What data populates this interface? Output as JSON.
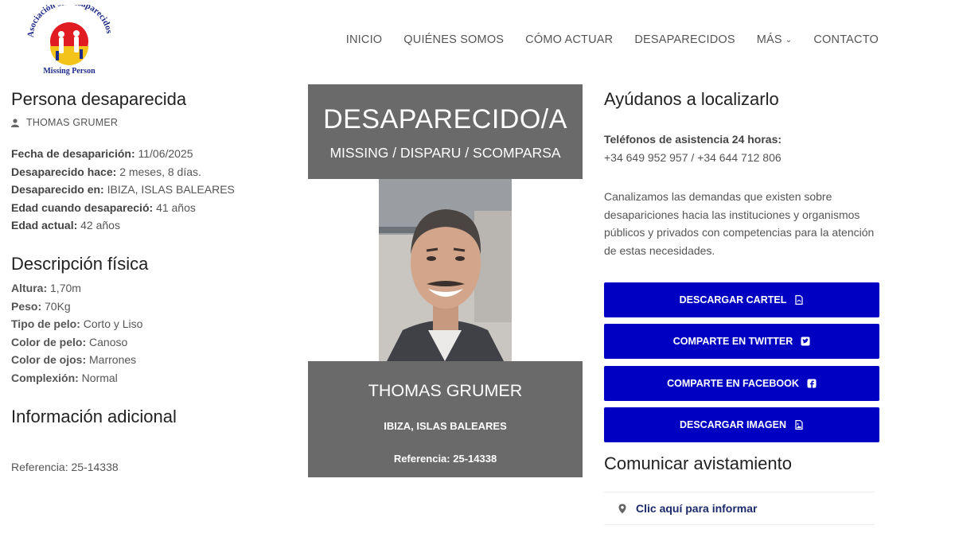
{
  "logo": {
    "arc_text": "Asociación sosdesaparecidos",
    "tagline": "Missing Person",
    "colors": {
      "red": "#e01c22",
      "yellow": "#f4c31a",
      "blue": "#1d2a8a"
    }
  },
  "nav": {
    "items": [
      "INICIO",
      "QUIÉNES SOMOS",
      "CÓMO ACTUAR",
      "DESAPARECIDOS",
      "MÁS",
      "CONTACTO"
    ]
  },
  "left": {
    "title": "Persona desaparecida",
    "author": "THOMAS GRUMER",
    "facts": [
      {
        "label": "Fecha de desaparición:",
        "value": "11/06/2025"
      },
      {
        "label": "Desaparecido hace:",
        "value": "2 meses, 8 días."
      },
      {
        "label": "Desaparecido en:",
        "value": "IBIZA, ISLAS BALEARES"
      },
      {
        "label": "Edad cuando desapareció:",
        "value": "41 años"
      },
      {
        "label": "Edad actual:",
        "value": "42 años"
      }
    ],
    "desc_title": "Descripción física",
    "physical": [
      {
        "label": "Altura:",
        "value": "1,70m"
      },
      {
        "label": "Peso:",
        "value": "70Kg"
      },
      {
        "label": "Tipo de pelo:",
        "value": "Corto y Liso"
      },
      {
        "label": "Color de pelo:",
        "value": "Canoso"
      },
      {
        "label": "Color de ojos:",
        "value": "Marrones"
      },
      {
        "label": "Complexión:",
        "value": "Normal"
      }
    ],
    "info_title": "Información adicional",
    "reference": "Referencia: 25-14338"
  },
  "poster": {
    "heading": "DESAPARECIDO/A",
    "subheading": "MISSING / DISPARU / SCOMPARSA",
    "name": "THOMAS GRUMER",
    "place": "IBIZA, ISLAS BALEARES",
    "reference": "Referencia: 25-14338",
    "bg_color": "#6a6a6a"
  },
  "right": {
    "title": "Ayúdanos a localizarlo",
    "phones_label": "Teléfonos de asistencia 24 horas:",
    "phones": "+34 649 952 957 / +34 644 712 806",
    "about": "Canalizamos las demandas que existen sobre desapariciones hacia las instituciones y organismos públicos y privados con competencias para la atención de estas necesidades.",
    "buttons": [
      {
        "label": "DESCARGAR CARTEL",
        "icon": "pdf-file-icon"
      },
      {
        "label": "COMPARTE EN TWITTER",
        "icon": "twitter-icon"
      },
      {
        "label": "COMPARTE EN FACEBOOK",
        "icon": "facebook-icon"
      },
      {
        "label": "DESCARGAR IMAGEN",
        "icon": "image-file-icon"
      }
    ],
    "button_color": "#0000c2",
    "report_title": "Comunicar avistamiento",
    "report_link": "Clic aquí para informar"
  }
}
